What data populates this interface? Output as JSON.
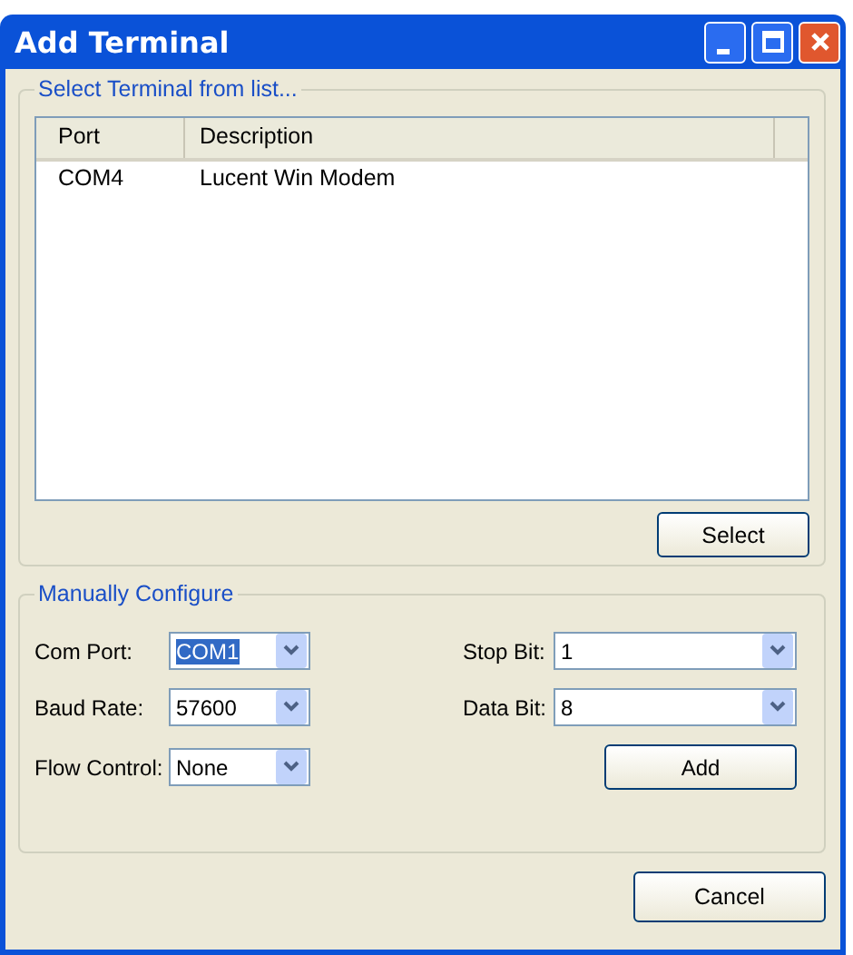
{
  "window": {
    "title": "Add Terminal"
  },
  "terminal_group": {
    "title": "Select Terminal from list...",
    "columns": [
      "Port",
      "Description"
    ],
    "rows": [
      {
        "cells": [
          "COM4",
          "Lucent Win Modem"
        ],
        "selected": false
      }
    ],
    "button": "Select"
  },
  "manual_group": {
    "title": "Manually Configure",
    "fields": [
      {
        "label": "Com Port:",
        "value": "COM1",
        "highlighted": true
      },
      {
        "label": "Stop Bit:",
        "value": "1",
        "highlighted": false
      },
      {
        "label": "Baud Rate:",
        "value": "57600",
        "highlighted": false
      },
      {
        "label": "Data Bit:",
        "value": "8",
        "highlighted": false
      },
      {
        "label": "Flow Control:",
        "value": "None",
        "highlighted": false
      }
    ],
    "button": "Add"
  },
  "buttons": [
    "Cancel"
  ]
}
